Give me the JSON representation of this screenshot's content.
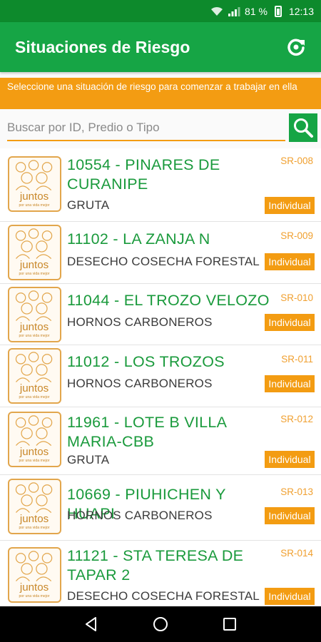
{
  "status_bar": {
    "battery": "81 %",
    "time": "12:13"
  },
  "app_bar": {
    "title": "Situaciones de Riesgo",
    "refresh_icon": "refresh-icon"
  },
  "banner": {
    "text": "Seleccione una situación de riesgo para comenzar a trabajar en ella"
  },
  "search": {
    "placeholder": "Buscar por ID, Predio o Tipo",
    "value": "",
    "icon": "search-icon"
  },
  "logo_text": {
    "main": "juntos",
    "tagline": "por una vida mejor"
  },
  "items": [
    {
      "title": "10554 - PINARES DE CURANIPE",
      "type": "GRUTA",
      "code": "SR-008",
      "badge": "Individual"
    },
    {
      "title": "11102 - LA ZANJA N",
      "type": "DESECHO COSECHA FORESTAL",
      "code": "SR-009",
      "badge": "Individual"
    },
    {
      "title": "11044 - EL TROZO VELOZO",
      "type": "HORNOS CARBONEROS",
      "code": "SR-010",
      "badge": "Individual"
    },
    {
      "title": "11012 - LOS TROZOS",
      "type": "HORNOS CARBONEROS",
      "code": "SR-011",
      "badge": "Individual"
    },
    {
      "title": "11961 - LOTE B VILLA MARIA-CBB",
      "type": "GRUTA",
      "code": "SR-012",
      "badge": "Individual"
    },
    {
      "title": "10669 - PIUHICHEN Y HUAPI",
      "type": "HORNOS CARBONEROS",
      "code": "SR-013",
      "badge": "Individual"
    },
    {
      "title": "11121 - STA TERESA DE TAPAR 2",
      "type": "DESECHO COSECHA FORESTAL",
      "code": "SR-014",
      "badge": "Individual"
    }
  ],
  "colors": {
    "primary": "#16a545",
    "status": "#0d8a2c",
    "accent": "#f39c12",
    "title_text": "#1a9a3c"
  },
  "nav_bar": {
    "icons": [
      "back-icon",
      "home-icon",
      "recents-icon"
    ]
  }
}
